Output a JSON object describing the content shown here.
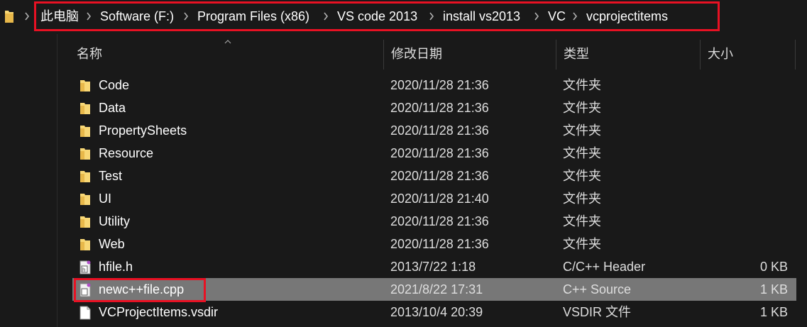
{
  "breadcrumb": {
    "items": [
      "此电脑",
      "Software (F:)",
      "Program Files (x86)",
      "VS code 2013",
      "install vs2013",
      "VC",
      "vcprojectitems"
    ]
  },
  "columns": {
    "name": "名称",
    "date": "修改日期",
    "type": "类型",
    "size": "大小"
  },
  "files": [
    {
      "name": "Code",
      "date": "2020/11/28 21:36",
      "type": "文件夹",
      "size": "",
      "icon": "folder-icon"
    },
    {
      "name": "Data",
      "date": "2020/11/28 21:36",
      "type": "文件夹",
      "size": "",
      "icon": "folder-icon"
    },
    {
      "name": "PropertySheets",
      "date": "2020/11/28 21:36",
      "type": "文件夹",
      "size": "",
      "icon": "folder-icon"
    },
    {
      "name": "Resource",
      "date": "2020/11/28 21:36",
      "type": "文件夹",
      "size": "",
      "icon": "folder-icon"
    },
    {
      "name": "Test",
      "date": "2020/11/28 21:36",
      "type": "文件夹",
      "size": "",
      "icon": "folder-icon"
    },
    {
      "name": "UI",
      "date": "2020/11/28 21:40",
      "type": "文件夹",
      "size": "",
      "icon": "folder-icon"
    },
    {
      "name": "Utility",
      "date": "2020/11/28 21:36",
      "type": "文件夹",
      "size": "",
      "icon": "folder-icon"
    },
    {
      "name": "Web",
      "date": "2020/11/28 21:36",
      "type": "文件夹",
      "size": "",
      "icon": "folder-icon"
    },
    {
      "name": "hfile.h",
      "date": "2013/7/22 1:18",
      "type": "C/C++ Header",
      "size": "0 KB",
      "icon": "header-file-icon"
    },
    {
      "name": "newc++file.cpp",
      "date": "2021/8/22 17:31",
      "type": "C++ Source",
      "size": "1 KB",
      "icon": "cpp-file-icon",
      "selected": true
    },
    {
      "name": "VCProjectItems.vsdir",
      "date": "2013/10/4 20:39",
      "type": "VSDIR 文件",
      "size": "1 KB",
      "icon": "document-icon"
    }
  ],
  "colors": {
    "background": "#191919",
    "selection": "#777777",
    "highlight_border": "#e81123",
    "folder": "#f8d775"
  }
}
